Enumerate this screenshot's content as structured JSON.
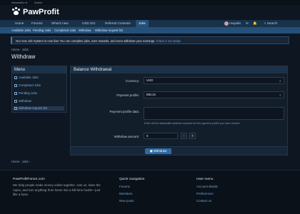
{
  "topbar": {
    "newsletter": "Newsletter ▾",
    "admin": "Admin"
  },
  "site": {
    "name": "PawProfit"
  },
  "nav": {
    "items": [
      "Home",
      "Forums",
      "What's new",
      "USD 401",
      "Referral Contests",
      "Jobs"
    ],
    "user": "mayalin",
    "search": "Search"
  },
  "subnav": {
    "items": [
      "Available Jobs",
      "Pending Jobs",
      "Completed Jobs",
      "Withdraw",
      "Withdraw request list"
    ]
  },
  "notice": {
    "text": "Our new Job System is now live! You can complete jobs, earn rewards, and even withdraw your earnings.",
    "link": "Check it out today!"
  },
  "breadcrumb": {
    "home": "Home",
    "jobs": "Jobs"
  },
  "page": {
    "title": "Withdraw"
  },
  "menu": {
    "title": "Menu",
    "items": [
      "Available Jobs",
      "Completed Jobs",
      "Pending Jobs",
      "Withdraw",
      "Withdraw request list"
    ]
  },
  "form": {
    "title": "Balance Withdrawal",
    "currency_label": "Currency:",
    "currency_value": "USD",
    "profile_label": "Payment profile:",
    "profile_value": "Bitcoin",
    "data_label": "Payment profile data:",
    "data_hint": "Enter all the data/wallet address required for the payment profile you have chosen",
    "amount_label": "Withdraw amount:",
    "amount_value": "0",
    "submit": "Withdraw"
  },
  "footer": {
    "site_title": "PawProfitForum.com",
    "site_text": "We help people make money online together. Join us, learn the ropes, and turn anything from home into a full-time hustle—just like a boss.",
    "quick_title": "Quick navigation",
    "quick_links": [
      "Forums",
      "Members",
      "New posts"
    ],
    "user_title": "User menu",
    "user_links": [
      "Account details",
      "Preferences",
      "Contact us"
    ]
  }
}
